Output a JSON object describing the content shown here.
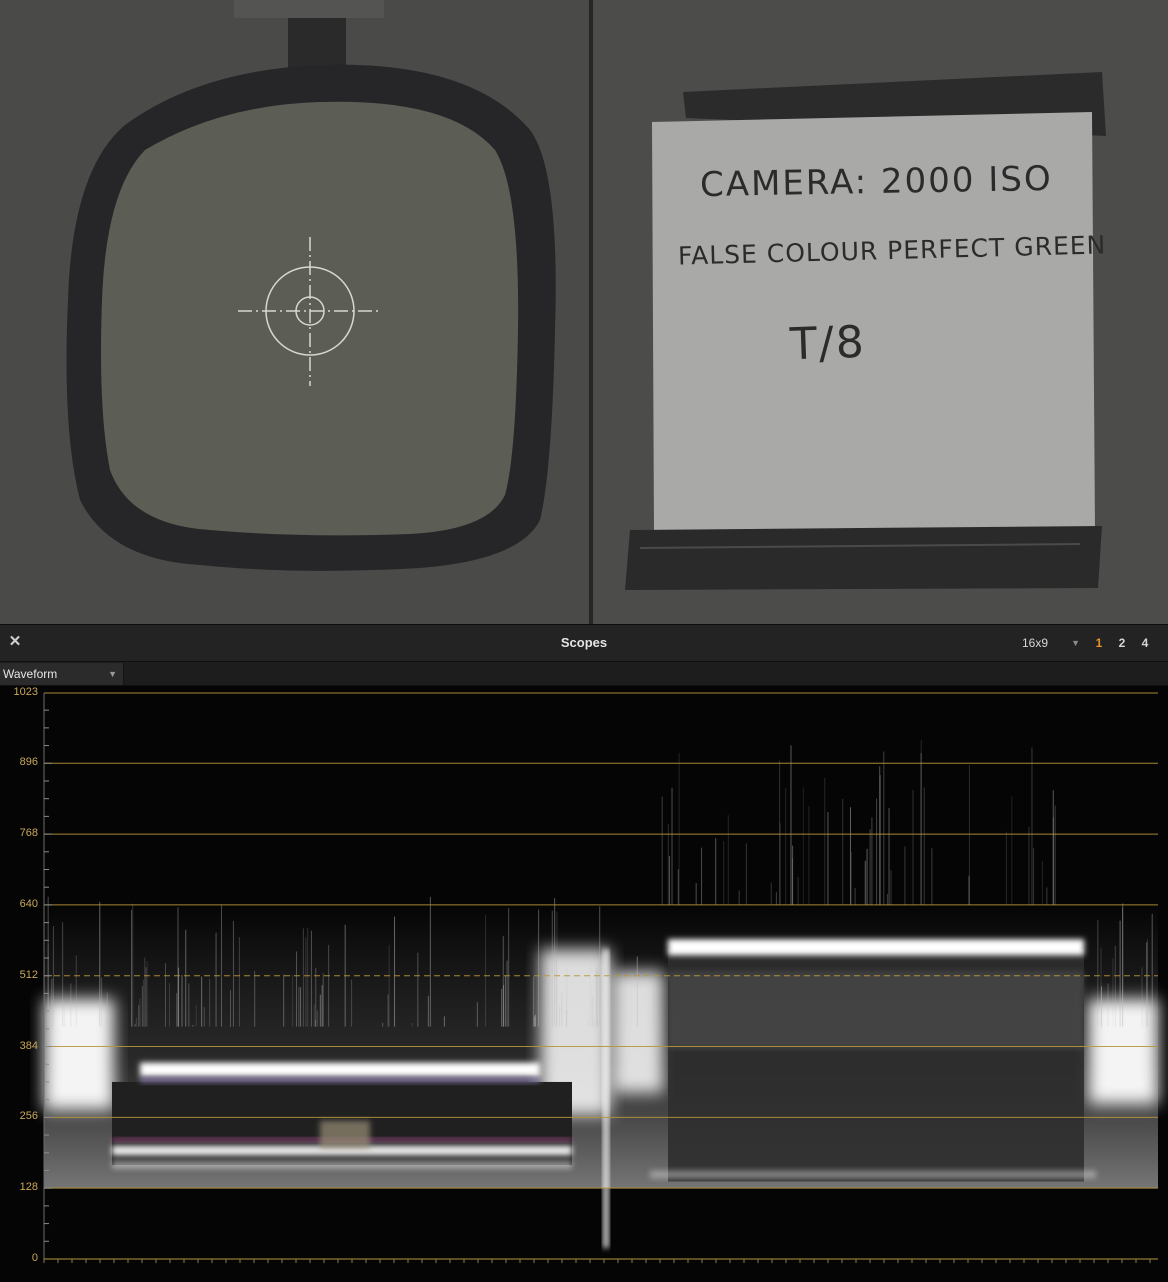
{
  "viewer": {
    "card_text": {
      "line1": "CAMERA: 2000 ISO",
      "line2": "FALSE COLOUR PERFECT GREEN",
      "line3": "T/8"
    }
  },
  "scopes_panel": {
    "title": "Scopes",
    "close_icon": "close-icon",
    "aspect_ratio": "16x9",
    "layout_options": [
      {
        "label": "1",
        "active": true
      },
      {
        "label": "2",
        "active": false
      },
      {
        "label": "4",
        "active": false
      }
    ],
    "scope_type": "Waveform"
  },
  "waveform": {
    "scale": [
      "1023",
      "896",
      "768",
      "640",
      "512",
      "384",
      "256",
      "128",
      "0"
    ],
    "scale_values": [
      1023,
      896,
      768,
      640,
      512,
      384,
      256,
      128,
      0
    ],
    "guide_color": "#b8953a"
  },
  "colors": {
    "accent": "#e8922b",
    "scale_text": "#c9a85a"
  }
}
